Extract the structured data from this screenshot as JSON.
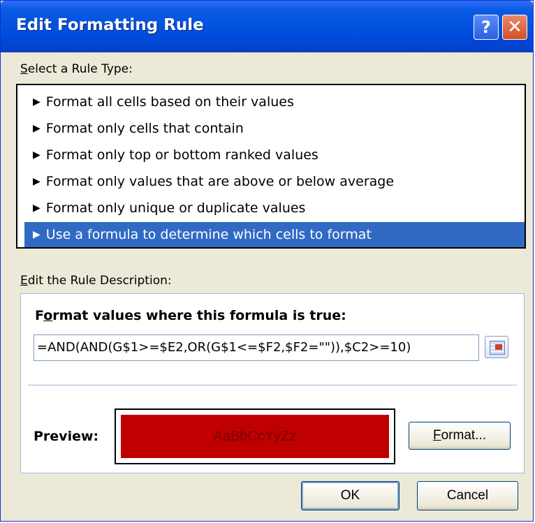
{
  "window": {
    "title": "Edit Formatting Rule",
    "help_label": "?",
    "close_label": "✕"
  },
  "rule_type": {
    "label_prefix": "S",
    "label_rest": "elect a Rule Type:",
    "items": [
      {
        "label": "Format all cells based on their values",
        "selected": false
      },
      {
        "label": "Format only cells that contain",
        "selected": false
      },
      {
        "label": "Format only top or bottom ranked values",
        "selected": false
      },
      {
        "label": "Format only values that are above or below average",
        "selected": false
      },
      {
        "label": "Format only unique or duplicate values",
        "selected": false
      },
      {
        "label": "Use a formula to determine which cells to format",
        "selected": true
      }
    ]
  },
  "description": {
    "label_prefix": "E",
    "label_rest": "dit the Rule Description:",
    "heading_prefix": "F",
    "heading_o": "o",
    "heading_rest": "rmat values where this formula is true:",
    "formula": "=AND(AND(G$1>=$E2,OR(G$1<=$F2,$F2=\"\")),$C2>=10)",
    "preview_label": "Preview:",
    "preview_text": "AaBbCcYyZz",
    "preview_color": "#c00000",
    "format_button_prefix": "F",
    "format_button_rest": "ormat..."
  },
  "buttons": {
    "ok": "OK",
    "cancel": "Cancel"
  },
  "colors": {
    "titlebar": "#0352e0",
    "selection": "#316ac5",
    "dialog_bg": "#ece9d8"
  }
}
